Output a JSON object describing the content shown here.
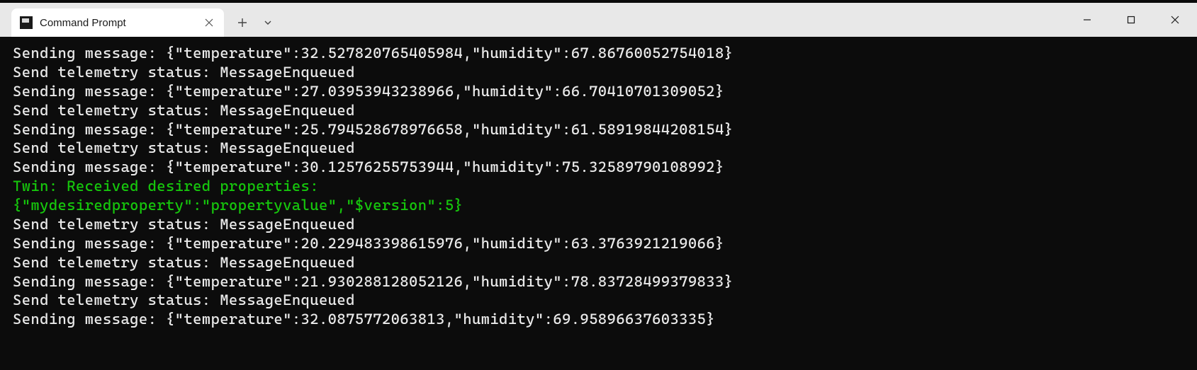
{
  "tab": {
    "title": "Command Prompt"
  },
  "terminal": {
    "lines": [
      {
        "text": "Sending message: {\"temperature\":32.527820765405984,\"humidity\":67.86760052754018}",
        "color": "default"
      },
      {
        "text": "Send telemetry status: MessageEnqueued",
        "color": "default"
      },
      {
        "text": "Sending message: {\"temperature\":27.03953943238966,\"humidity\":66.70410701309052}",
        "color": "default"
      },
      {
        "text": "Send telemetry status: MessageEnqueued",
        "color": "default"
      },
      {
        "text": "Sending message: {\"temperature\":25.794528678976658,\"humidity\":61.58919844208154}",
        "color": "default"
      },
      {
        "text": "Send telemetry status: MessageEnqueued",
        "color": "default"
      },
      {
        "text": "Sending message: {\"temperature\":30.12576255753944,\"humidity\":75.32589790108992}",
        "color": "default"
      },
      {
        "text": "Twin: Received desired properties:",
        "color": "green"
      },
      {
        "text": "{\"mydesiredproperty\":\"propertyvalue\",\"$version\":5}",
        "color": "green"
      },
      {
        "text": "Send telemetry status: MessageEnqueued",
        "color": "default"
      },
      {
        "text": "Sending message: {\"temperature\":20.229483398615976,\"humidity\":63.3763921219066}",
        "color": "default"
      },
      {
        "text": "Send telemetry status: MessageEnqueued",
        "color": "default"
      },
      {
        "text": "Sending message: {\"temperature\":21.930288128052126,\"humidity\":78.83728499379833}",
        "color": "default"
      },
      {
        "text": "Send telemetry status: MessageEnqueued",
        "color": "default"
      },
      {
        "text": "Sending message: {\"temperature\":32.0875772063813,\"humidity\":69.95896637603335}",
        "color": "default"
      }
    ]
  }
}
